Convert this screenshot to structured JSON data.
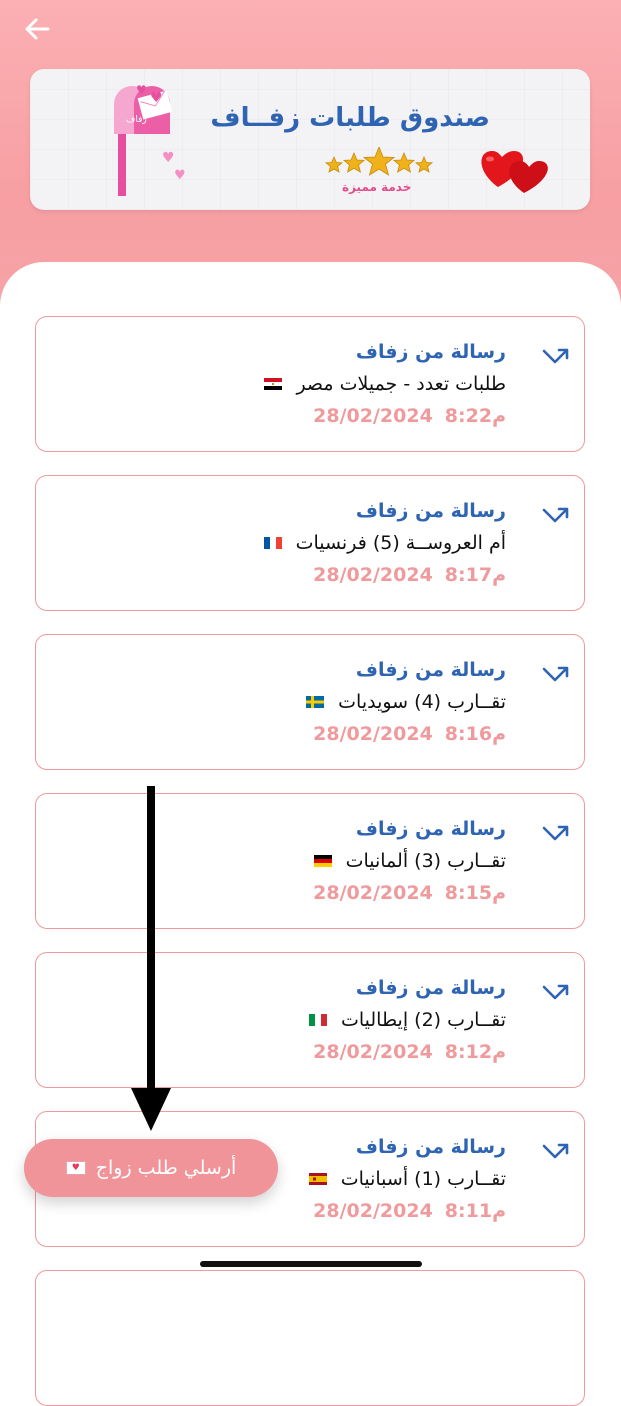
{
  "header": {
    "back_icon": "back-arrow-icon"
  },
  "banner": {
    "title": "صندوق طلبات زفــاف",
    "subtitle": "خدمة مميزة",
    "mailbox_text": "زفاف",
    "star_count": 5,
    "colors": {
      "title": "#2f64b2",
      "subtitle": "#e14c8c",
      "hearts": "#e3161c"
    }
  },
  "messages": [
    {
      "from": "رسالة من زفاف",
      "subject": "طلبات تعدد - جميلات مصر",
      "flag": "egypt-flag-icon",
      "time": "8:22م",
      "date": "28/02/2024"
    },
    {
      "from": "رسالة من زفاف",
      "subject": "أم العروســة (5) فرنسيات",
      "flag": "france-flag-icon",
      "time": "8:17م",
      "date": "28/02/2024"
    },
    {
      "from": "رسالة من زفاف",
      "subject": "تقــارب (4) سويديات",
      "flag": "sweden-flag-icon",
      "time": "8:16م",
      "date": "28/02/2024"
    },
    {
      "from": "رسالة من زفاف",
      "subject": "تقــارب (3) ألمانيات",
      "flag": "germany-flag-icon",
      "time": "8:15م",
      "date": "28/02/2024"
    },
    {
      "from": "رسالة من زفاف",
      "subject": "تقــارب (2) إيطاليات",
      "flag": "italy-flag-icon",
      "time": "8:12م",
      "date": "28/02/2024"
    },
    {
      "from": "رسالة من زفاف",
      "subject": "تقــارب (1) أسبانيات",
      "flag": "spain-flag-icon",
      "time": "8:11م",
      "date": "28/02/2024"
    }
  ],
  "fab": {
    "label": "أرسلي طلب زواج",
    "icon": "envelope-heart-icon"
  },
  "colors": {
    "accent_pink": "#f19499",
    "card_border": "#ef9a9c",
    "link_blue": "#2f64b2"
  }
}
